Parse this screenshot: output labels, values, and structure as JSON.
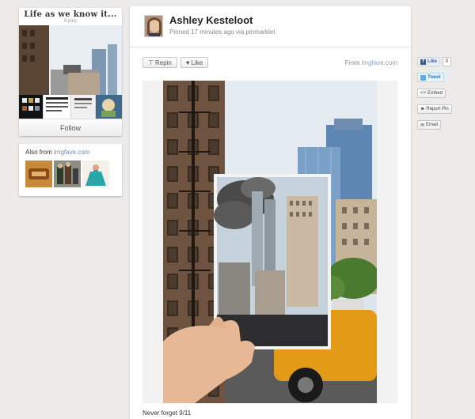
{
  "board": {
    "title": "Life as we know it...",
    "pin_count": "5 pins",
    "follow_label": "Follow"
  },
  "also_from": {
    "prefix": "Also from",
    "domain": "imgfave.com"
  },
  "pin": {
    "user_name": "Ashley Kesteloot",
    "meta": "Pinned 17 minutes ago via pinmarklet",
    "repin_label": "Repin",
    "like_label": "Like",
    "source_prefix": "From",
    "source_domain": "imgfave.com",
    "caption": "Never forget 9/11"
  },
  "share": {
    "facebook_label": "Like",
    "facebook_count": "0",
    "tweet_label": "Tweet",
    "embed_label": "Embed",
    "report_label": "Report Pin",
    "email_label": "Email"
  },
  "colors": {
    "background": "#ecebea",
    "link": "#8aa0b8",
    "facebook": "#3b5998",
    "twitter": "#55acee"
  }
}
